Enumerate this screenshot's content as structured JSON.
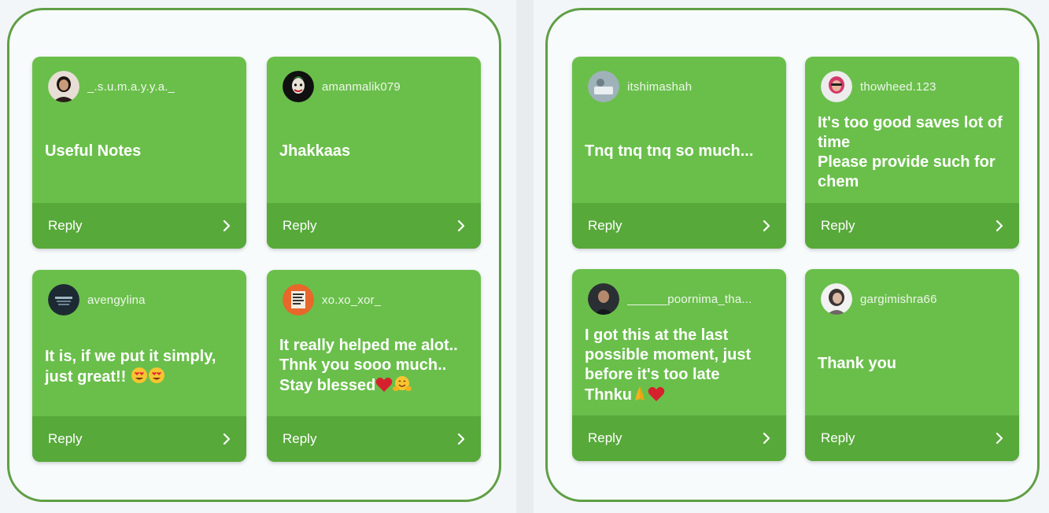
{
  "reply_label": "Reply",
  "colors": {
    "card": "#6abf4b",
    "reply_bar": "#57a93a",
    "panel_border": "#5f9f45",
    "text": "#ffffff"
  },
  "cards": [
    {
      "username": "_.s.u.m.a.y.y.a._",
      "message": "Useful Notes",
      "avatar": "avatar-photo"
    },
    {
      "username": "amanmalik079",
      "message": "Jhakkaas",
      "avatar": "avatar-joker"
    },
    {
      "username": "avengylina",
      "message": "It is, if we put it simply,\njust great!!",
      "avatar": "avatar-dark-logo"
    },
    {
      "username": "xo.xo_xor_",
      "message": "It really helped me alot..\nThnk you sooo much..\nStay blessed",
      "avatar": "avatar-orange-poster"
    },
    {
      "username": "itshimashah",
      "message": "Tnq tnq tnq so much...",
      "avatar": "avatar-photo"
    },
    {
      "username": "thowheed.123",
      "message": "It's too good saves lot of\ntime\nPlease provide such for\nchem",
      "avatar": "avatar-photo"
    },
    {
      "username": "______poornima_tha...",
      "message": "I got this at the last\npossible moment, just\nbefore it's too late\nThnku",
      "avatar": "avatar-photo"
    },
    {
      "username": "gargimishra66",
      "message": "Thank you",
      "avatar": "avatar-photo"
    }
  ]
}
